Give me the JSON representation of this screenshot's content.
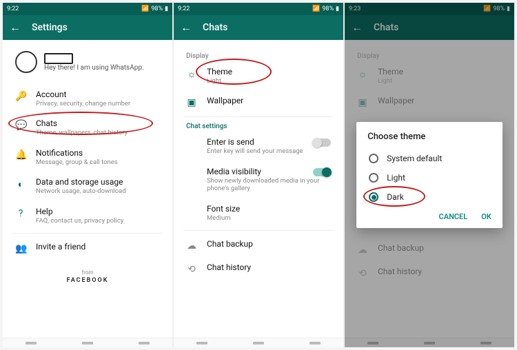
{
  "status": {
    "time1": "9:22",
    "time2": "9:22",
    "time3": "9:23",
    "battery": "98%"
  },
  "screens": {
    "settings": {
      "title": "Settings",
      "profile_status": "Hey there! I am using WhatsApp.",
      "items": [
        {
          "icon": "key-icon",
          "title": "Account",
          "sub": "Privacy, security, change number"
        },
        {
          "icon": "chat-icon",
          "title": "Chats",
          "sub": "Theme, wallpapers, chat history"
        },
        {
          "icon": "bell-icon",
          "title": "Notifications",
          "sub": "Message, group & call tones"
        },
        {
          "icon": "data-icon",
          "title": "Data and storage usage",
          "sub": "Network usage, auto-download"
        },
        {
          "icon": "help-icon",
          "title": "Help",
          "sub": "FAQ, contact us, privacy policy"
        },
        {
          "icon": "people-icon",
          "title": "Invite a friend",
          "sub": ""
        }
      ],
      "footer_from": "from",
      "footer_brand": "FACEBOOK"
    },
    "chats": {
      "title": "Chats",
      "section_display": "Display",
      "theme": {
        "title": "Theme",
        "value": "Light"
      },
      "wallpaper": "Wallpaper",
      "section_settings": "Chat settings",
      "enter_send": {
        "title": "Enter is send",
        "sub": "Enter key will send your message"
      },
      "media_vis": {
        "title": "Media visibility",
        "sub": "Show newly downloaded media in your phone's gallery"
      },
      "font_size": {
        "title": "Font size",
        "value": "Medium"
      },
      "backup": "Chat backup",
      "history": "Chat history"
    },
    "dialog": {
      "title": "Choose theme",
      "options": [
        "System default",
        "Light",
        "Dark"
      ],
      "cancel": "CANCEL",
      "ok": "OK"
    }
  }
}
